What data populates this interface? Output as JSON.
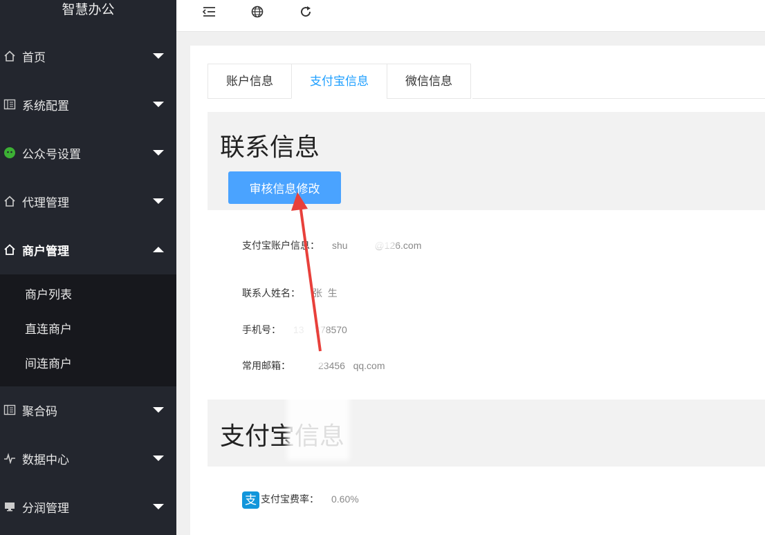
{
  "app": {
    "title": "智慧办公"
  },
  "sidebar": {
    "items": [
      {
        "label": "首页",
        "icon": "home-icon"
      },
      {
        "label": "系统配置",
        "icon": "book-icon"
      },
      {
        "label": "公众号设置",
        "icon": "wechat-icon"
      },
      {
        "label": "代理管理",
        "icon": "home-icon"
      },
      {
        "label": "商户管理",
        "icon": "home-icon",
        "expanded": true
      },
      {
        "label": "聚合码",
        "icon": "book-icon"
      },
      {
        "label": "数据中心",
        "icon": "pulse-icon"
      },
      {
        "label": "分润管理",
        "icon": "monitor-icon"
      }
    ],
    "submenu": [
      "商户列表",
      "直连商户",
      "间连商户"
    ]
  },
  "topbar": {
    "icons": [
      "menu-fold-icon",
      "globe-icon",
      "refresh-icon"
    ]
  },
  "tabs": [
    {
      "label": "账户信息"
    },
    {
      "label": "支付宝信息",
      "active": true
    },
    {
      "label": "微信信息"
    }
  ],
  "contact": {
    "title": "联系信息",
    "audit_button": "审核信息修改",
    "account_label": "支付宝账户信息：",
    "account_value": "shu          @126.com",
    "name_label": "联系人姓名：",
    "name_value": "张  生",
    "phone_label": "手机号：",
    "phone_value": "13    878570",
    "email_label": "常用邮箱：",
    "email_value": "23456   qq.com"
  },
  "alipay": {
    "title": "支付宝信息",
    "badge": "支",
    "rate_label": "支付宝费率：",
    "rate_value": "0.60%"
  },
  "colors": {
    "sidebar_bg": "#23262e",
    "accent": "#1e9fff",
    "button": "#4aa3ff",
    "arrow": "#e8403b"
  }
}
